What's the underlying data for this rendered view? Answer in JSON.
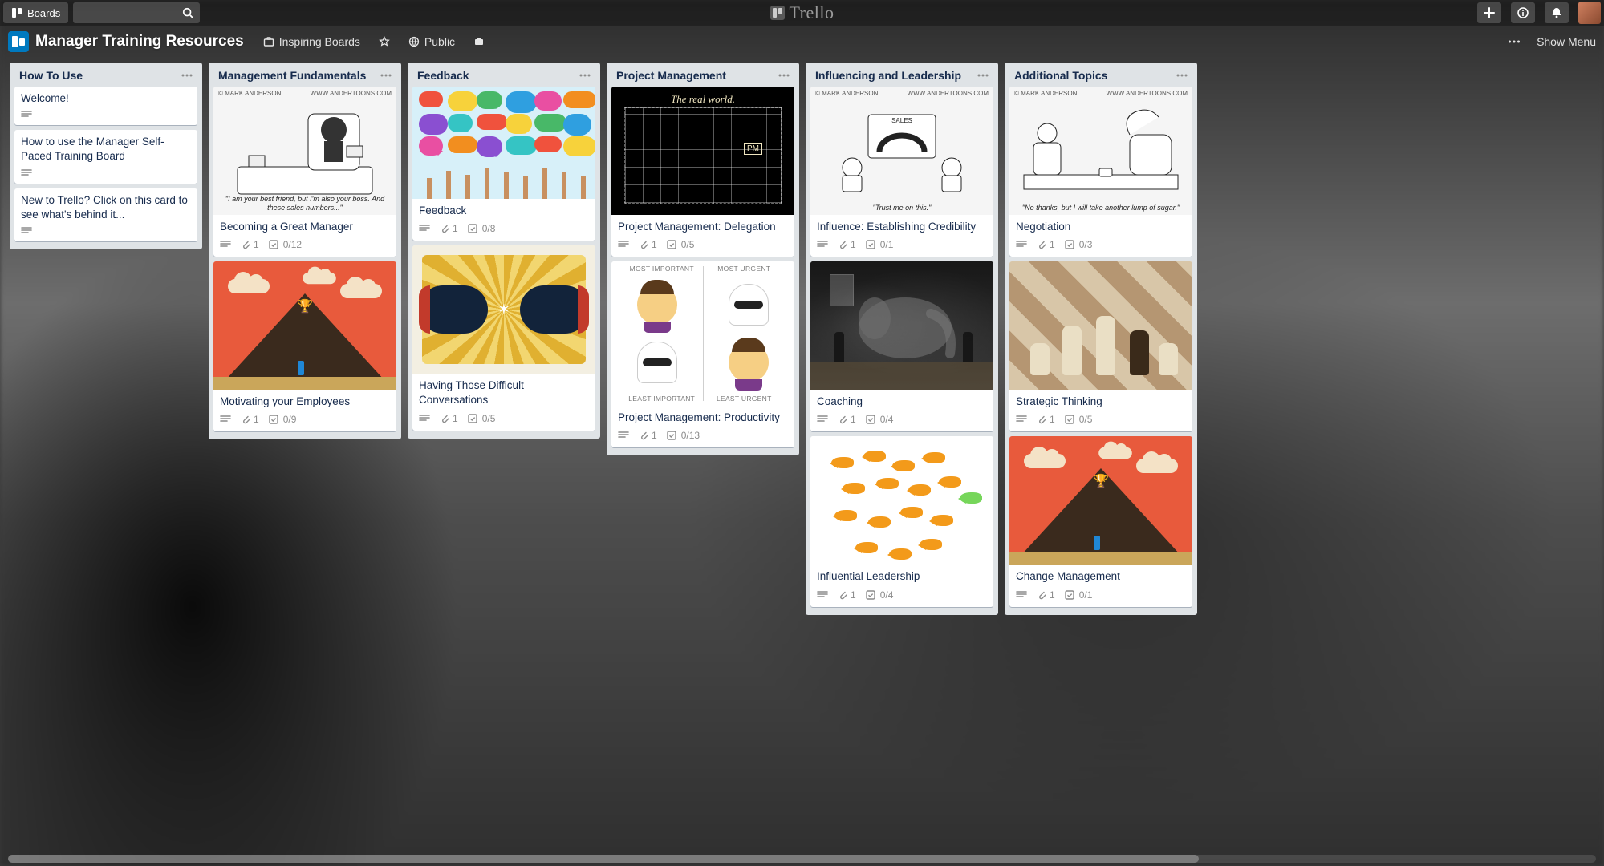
{
  "app": {
    "logo_text": "Trello",
    "boards_button": "Boards",
    "show_menu": "Show Menu"
  },
  "board": {
    "name": "Manager Training Resources",
    "org": "Inspiring Boards",
    "visibility": "Public"
  },
  "cartoons": {
    "credit": "© MARK ANDERSON",
    "site": "WWW.ANDERTOONS.COM",
    "manager_caption": "\"I am your best friend, but I'm also your boss. And these sales numbers...\"",
    "credibility_caption": "\"Trust me on this.\"",
    "negotiation_caption": "\"No thanks, but I will take another lump of sugar.\"",
    "realworld_title": "The real world.",
    "realworld_badge": "PM"
  },
  "matrix": {
    "top_left": "MOST IMPORTANT",
    "top_right": "MOST URGENT",
    "bottom_left": "LEAST IMPORTANT",
    "bottom_right": "LEAST URGENT"
  },
  "lists": [
    {
      "title": "How To Use",
      "cards": [
        {
          "title": "Welcome!",
          "desc": true
        },
        {
          "title": "How to use the Manager Self-Paced Training Board",
          "desc": true
        },
        {
          "title": "New to Trello? Click on this card to see what's behind it...",
          "desc": true
        }
      ]
    },
    {
      "title": "Management Fundamentals",
      "cards": [
        {
          "title": "Becoming a Great Manager",
          "desc": true,
          "attachments": "1",
          "checklist": "0/12",
          "cover": "cartoon-manager"
        },
        {
          "title": "Motivating your Employees",
          "desc": true,
          "attachments": "1",
          "checklist": "0/9",
          "cover": "volcano"
        }
      ]
    },
    {
      "title": "Feedback",
      "cards": [
        {
          "title": "Feedback",
          "desc": true,
          "attachments": "1",
          "checklist": "0/8",
          "cover": "bubbles"
        },
        {
          "title": "Having Those Difficult Conversations",
          "desc": true,
          "attachments": "1",
          "checklist": "0/5",
          "cover": "fists"
        }
      ]
    },
    {
      "title": "Project Management",
      "cards": [
        {
          "title": "Project Management: Delegation",
          "desc": true,
          "attachments": "1",
          "checklist": "0/5",
          "cover": "realworld"
        },
        {
          "title": "Project Management: Productivity",
          "desc": true,
          "attachments": "1",
          "checklist": "0/13",
          "cover": "matrix"
        }
      ]
    },
    {
      "title": "Influencing and Leadership",
      "cards": [
        {
          "title": "Influence: Establishing Credibility",
          "desc": true,
          "attachments": "1",
          "checklist": "0/1",
          "cover": "cartoon-credibility"
        },
        {
          "title": "Coaching",
          "desc": true,
          "attachments": "1",
          "checklist": "0/4",
          "cover": "elephant"
        },
        {
          "title": "Influential Leadership",
          "desc": true,
          "attachments": "1",
          "checklist": "0/4",
          "cover": "fish"
        }
      ]
    },
    {
      "title": "Additional Topics",
      "cards": [
        {
          "title": "Negotiation",
          "desc": true,
          "attachments": "1",
          "checklist": "0/3",
          "cover": "cartoon-negotiation"
        },
        {
          "title": "Strategic Thinking",
          "desc": true,
          "attachments": "1",
          "checklist": "0/5",
          "cover": "chess"
        },
        {
          "title": "Change Management",
          "desc": true,
          "attachments": "1",
          "checklist": "0/1",
          "cover": "volcano"
        }
      ]
    }
  ]
}
